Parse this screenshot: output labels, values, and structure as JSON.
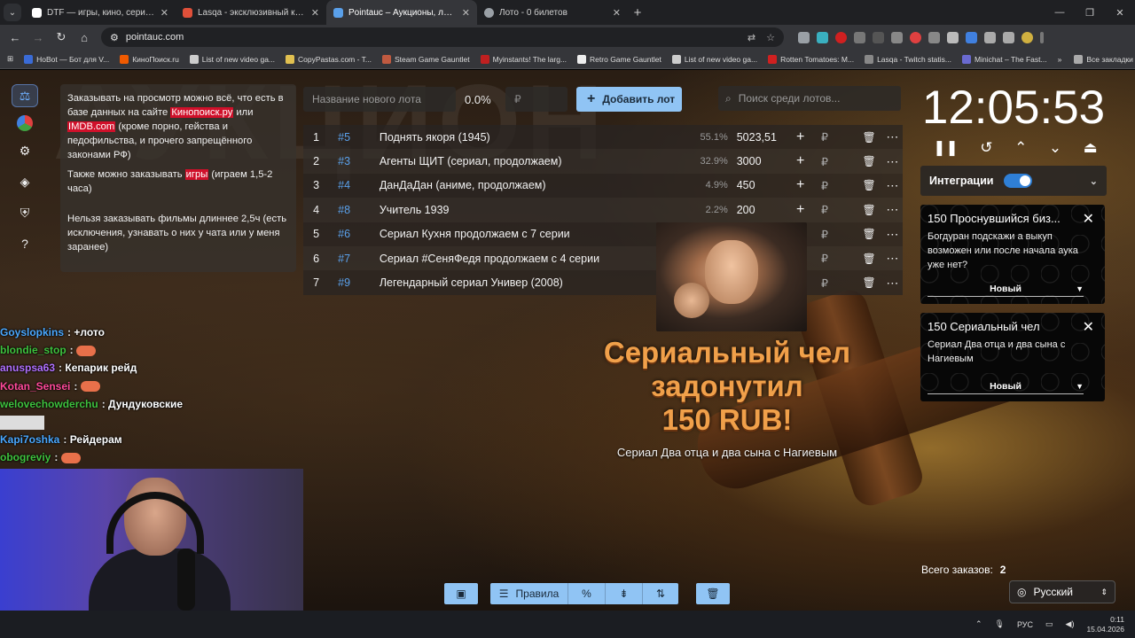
{
  "tabs": [
    {
      "title": "DTF — игры, кино, сериалы, р",
      "color": "#ffffff",
      "active": false
    },
    {
      "title": "Lasqa - эксклюзивный контен",
      "color": "#e0503a",
      "active": false
    },
    {
      "title": "Pointauc – Аукционы, лотереи",
      "color": "#5aa0ea",
      "active": true
    },
    {
      "title": "Лото - 0 билетов",
      "color": "#9aa0a6",
      "active": false
    }
  ],
  "url": "pointauc.com",
  "bookmarks": [
    {
      "label": "HoBot — Бот для V...",
      "color": "#3a6bd6"
    },
    {
      "label": "КиноПоиск.ru",
      "color": "#f05a00"
    },
    {
      "label": "List of new video ga...",
      "color": "#cccccc"
    },
    {
      "label": "CopyPastas.com - T...",
      "color": "#e0c050"
    },
    {
      "label": "Steam Game Gauntlet",
      "color": "#c05a40"
    },
    {
      "label": "Myinstants! The larg...",
      "color": "#c02020"
    },
    {
      "label": "Retro Game Gauntlet",
      "color": "#eeeeee"
    },
    {
      "label": "List of new video ga...",
      "color": "#cccccc"
    },
    {
      "label": "Rotten Tomatoes: M...",
      "color": "#d02020"
    },
    {
      "label": "Lasqa - Twitch statis...",
      "color": "#888888"
    },
    {
      "label": "Minichat – The Fast...",
      "color": "#6a6ad0"
    }
  ],
  "bookmarks_all": "Все закладки",
  "rules": {
    "p1_a": "Заказывать на просмотр можно всё, что есть в базе данных на сайте ",
    "p1_link1": "Кинопоиск.ру",
    "p1_b": " или ",
    "p1_link2": "IMDB.com",
    "p1_c": " (кроме порно, гейства и педофильства, и прочего запрещённого законами РФ)",
    "p2_a": "Также можно заказывать ",
    "p2_hl": "игры",
    "p2_b": " (играем 1,5-2 часа)",
    "p3": "Нельзя заказывать фильмы длиннее 2,5ч (есть исключения, узнавать о них у чата или у меня заранее)"
  },
  "new_lot": {
    "placeholder": "Название нового лота",
    "percent": "0.0%",
    "rub_placeholder": "₽",
    "add_label": "Добавить лот"
  },
  "search_placeholder": "Поиск среди лотов...",
  "lots": [
    {
      "n": "1",
      "id": "#5",
      "title": "Поднять якоря (1945)",
      "pct": "55.1%",
      "amount": "5023,51"
    },
    {
      "n": "2",
      "id": "#3",
      "title": "Агенты ЩИТ (сериал, продолжаем)",
      "pct": "32.9%",
      "amount": "3000"
    },
    {
      "n": "3",
      "id": "#4",
      "title": "ДанДаДан (аниме, продолжаем)",
      "pct": "4.9%",
      "amount": "450"
    },
    {
      "n": "4",
      "id": "#8",
      "title": "Учитель 1939",
      "pct": "2.2%",
      "amount": "200"
    },
    {
      "n": "5",
      "id": "#6",
      "title": "Сериал Кухня продолжаем с 7 серии",
      "pct": "",
      "amount": ""
    },
    {
      "n": "6",
      "id": "#7",
      "title": "Сериал #СеняФедя продолжаем с 4 серии",
      "pct": "",
      "amount": ""
    },
    {
      "n": "7",
      "id": "#9",
      "title": "Легендарный сериал Универ (2008)",
      "pct": "",
      "amount": ""
    }
  ],
  "rub": "₽",
  "donation": {
    "line1": "Сериальный чел задонутил",
    "line2": "150 RUB!",
    "message": "Сериал Два отца и два сына с Нагиевым"
  },
  "timer": "12:05:53",
  "integrations_label": "Интеграции",
  "cards": [
    {
      "title": "150 Проснувшийся биз...",
      "text": "Богдуран подскажи а выкуп возможен или после начала аука уже нет?",
      "status": "Новый"
    },
    {
      "title": "150 Сериальный чел",
      "text": "Сериал Два отца и два сына с Нагиевым",
      "status": "Новый"
    }
  ],
  "total_label": "Всего заказов:",
  "total_value": "2",
  "language": "Русский",
  "bottom_toolbar": {
    "rules_label": "Правила"
  },
  "chat": [
    {
      "user": "Goyslopkins",
      "color": "#4aa8ff",
      "msg": "+лото"
    },
    {
      "user": "blondie_stop",
      "color": "#3ec23e",
      "msg": ""
    },
    {
      "user": "anuspsa63",
      "color": "#b070ff",
      "msg": "Кепарик рейд"
    },
    {
      "user": "Kotan_Sensei",
      "color": "#ff4a9a",
      "msg": ""
    },
    {
      "user": "welovechowderchu",
      "color": "#3ec23e",
      "msg": "Дундуковские"
    },
    {
      "user": "",
      "color": "#ffffff",
      "msg": ""
    },
    {
      "user": "Kapi7oshka",
      "color": "#4aa8ff",
      "msg": "Рейдерам"
    },
    {
      "user": "obogreviy",
      "color": "#3ec23e",
      "msg": ""
    }
  ],
  "taskbar": {
    "lang": "РУС",
    "time": "0:11",
    "date": "15.04.2026"
  }
}
